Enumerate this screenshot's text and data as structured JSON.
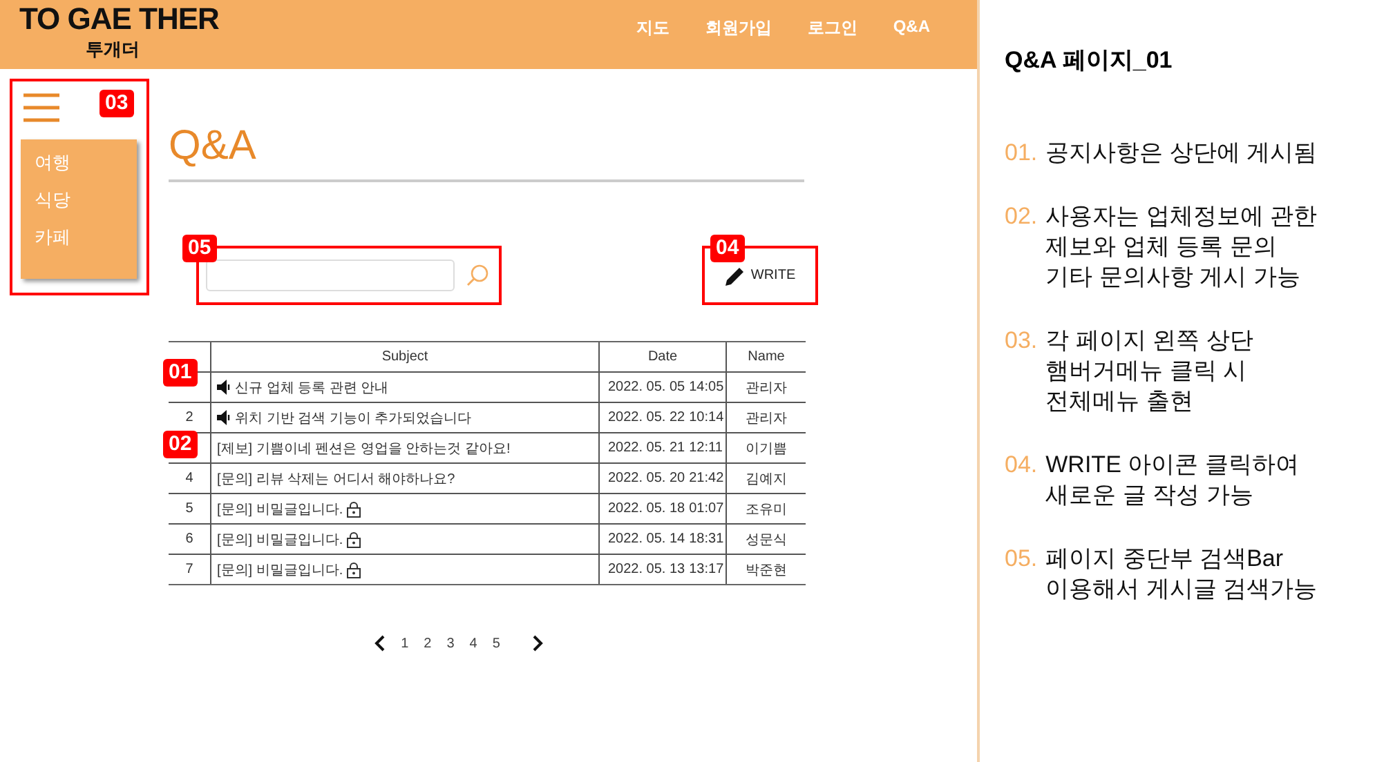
{
  "header": {
    "logo": "TO GAE THER",
    "logo_sub": "투개더",
    "nav": [
      "지도",
      "회원가입",
      "로그인",
      "Q&A"
    ]
  },
  "sidebar": {
    "badge": "03",
    "menu": [
      "여행",
      "식당",
      "카페"
    ]
  },
  "page": {
    "title": "Q&A",
    "search": {
      "badge": "05"
    },
    "write": {
      "badge": "04",
      "label": "WRITE"
    }
  },
  "table": {
    "columns": [
      "Subject",
      "Date",
      "Name"
    ],
    "rows": [
      {
        "kind": "notice",
        "badge": "01",
        "subject": "신규 업체 등록 관련 안내",
        "date": "2022. 05. 05",
        "time": "14:05",
        "name": "관리자"
      },
      {
        "kind": "notice",
        "number": "2",
        "subject": "위치 기반 검색 기능이 추가되었습니다",
        "date": "2022. 05. 22",
        "time": "10:14",
        "name": "관리자"
      },
      {
        "kind": "plain",
        "badge": "02",
        "subject": "[제보] 기쁨이네 펜션은 영업을 안하는것 같아요!",
        "date": "2022. 05. 21",
        "time": "12:11",
        "name": "이기쁨"
      },
      {
        "kind": "plain",
        "number": "4",
        "subject": "[문의] 리뷰 삭제는 어디서 해야하나요?",
        "date": "2022. 05. 20",
        "time": "21:42",
        "name": "김예지"
      },
      {
        "kind": "secret",
        "number": "5",
        "subject": "[문의] 비밀글입니다.",
        "date": "2022. 05. 18",
        "time": "01:07",
        "name": "조유미"
      },
      {
        "kind": "secret",
        "number": "6",
        "subject": "[문의] 비밀글입니다.",
        "date": "2022. 05. 14",
        "time": "18:31",
        "name": "성문식"
      },
      {
        "kind": "secret",
        "number": "7",
        "subject": "[문의] 비밀글입니다.",
        "date": "2022. 05. 13",
        "time": "13:17",
        "name": "박준현"
      }
    ]
  },
  "pagination": {
    "pages": [
      "1",
      "2",
      "3",
      "4",
      "5"
    ]
  },
  "notes": {
    "title": "Q&A 페이지_01",
    "items": [
      {
        "number": "01.",
        "lines": [
          "공지사항은 상단에 게시됨"
        ]
      },
      {
        "number": "02.",
        "lines": [
          "사용자는 업체정보에 관한",
          "제보와 업체 등록 문의",
          "기타 문의사항 게시 가능"
        ]
      },
      {
        "number": "03.",
        "lines": [
          "각 페이지 왼쪽 상단",
          "햄버거메뉴 클릭 시",
          "전체메뉴 출현"
        ]
      },
      {
        "number": "04.",
        "lines": [
          "WRITE 아이콘 클릭하여",
          "새로운 글 작성 가능"
        ]
      },
      {
        "number": "05.",
        "lines": [
          "페이지 중단부 검색Bar",
          "이용해서 게시글 검색가능"
        ]
      }
    ]
  }
}
